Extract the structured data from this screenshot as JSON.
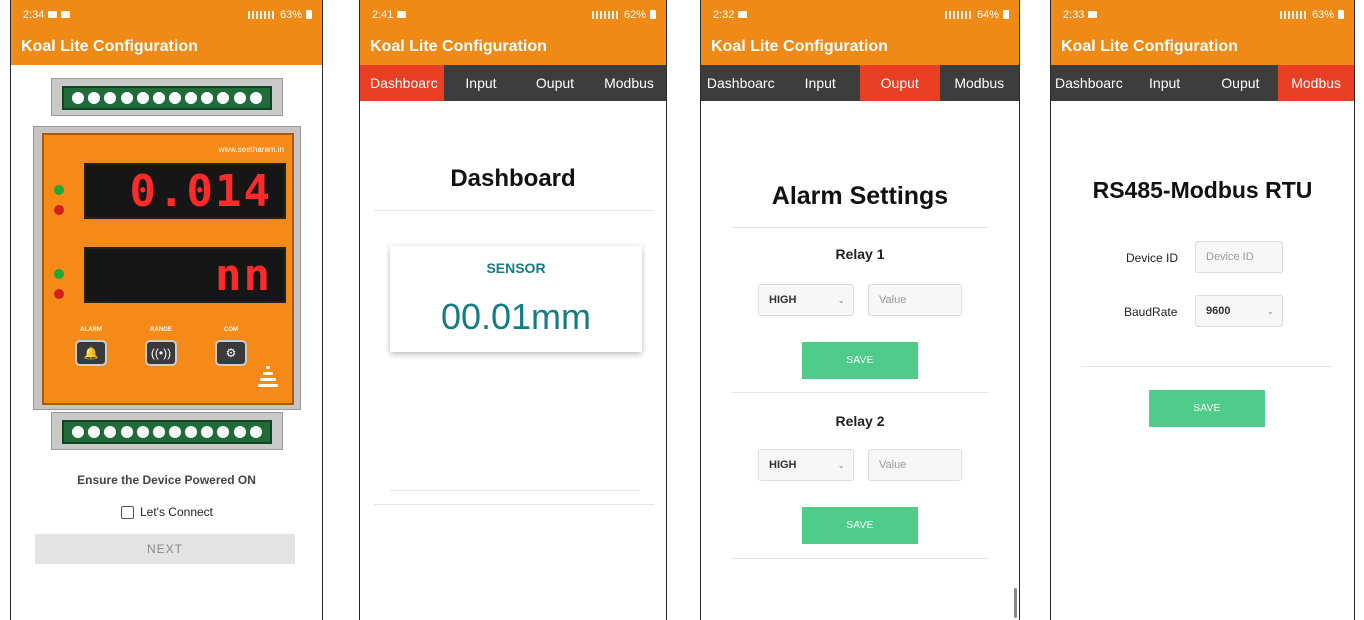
{
  "accent_colors": {
    "orange": "#f08a17",
    "active_tab": "#e73e24",
    "tab_bar": "#3d3d3d",
    "save_green": "#4fcb8a",
    "teal": "#137d85"
  },
  "screens": [
    {
      "status": {
        "time": "2:34",
        "battery": "63%"
      },
      "app_title": "Koal Lite Configuration",
      "device": {
        "url": "www.seetharam.in",
        "display1": "0.014",
        "display2": "nn",
        "buttons": [
          {
            "label": "ALARM",
            "icon": "bell-icon"
          },
          {
            "label": "RANGE",
            "icon": "signal-icon"
          },
          {
            "label": "COM",
            "icon": "network-icon"
          }
        ]
      },
      "instruction": "Ensure the Device Powered ON",
      "checkbox_label": "Let's Connect",
      "next_label": "NEXT"
    },
    {
      "status": {
        "time": "2:41",
        "battery": "62%"
      },
      "app_title": "Koal Lite Configuration",
      "tabs": [
        "Dashboarc",
        "Input",
        "Ouput",
        "Modbus"
      ],
      "active_tab": 0,
      "heading": "Dashboard",
      "card": {
        "label": "SENSOR",
        "value": "00.01mm"
      }
    },
    {
      "status": {
        "time": "2:32",
        "battery": "64%"
      },
      "app_title": "Koal Lite Configuration",
      "tabs": [
        "Dashboarc",
        "Input",
        "Ouput",
        "Modbus"
      ],
      "active_tab": 2,
      "heading": "Alarm Settings",
      "relays": [
        {
          "title": "Relay 1",
          "mode": "HIGH",
          "value_placeholder": "Value",
          "save_label": "SAVE"
        },
        {
          "title": "Relay 2",
          "mode": "HIGH",
          "value_placeholder": "Value",
          "save_label": "SAVE"
        }
      ]
    },
    {
      "status": {
        "time": "2:33",
        "battery": "63%"
      },
      "app_title": "Koal Lite Configuration",
      "tabs": [
        "Dashboarc",
        "Input",
        "Ouput",
        "Modbus"
      ],
      "active_tab": 3,
      "heading": "RS485-Modbus RTU",
      "device_id_label": "Device ID",
      "device_id_placeholder": "Device ID",
      "baudrate_label": "BaudRate",
      "baudrate_value": "9600",
      "save_label": "SAVE"
    }
  ]
}
